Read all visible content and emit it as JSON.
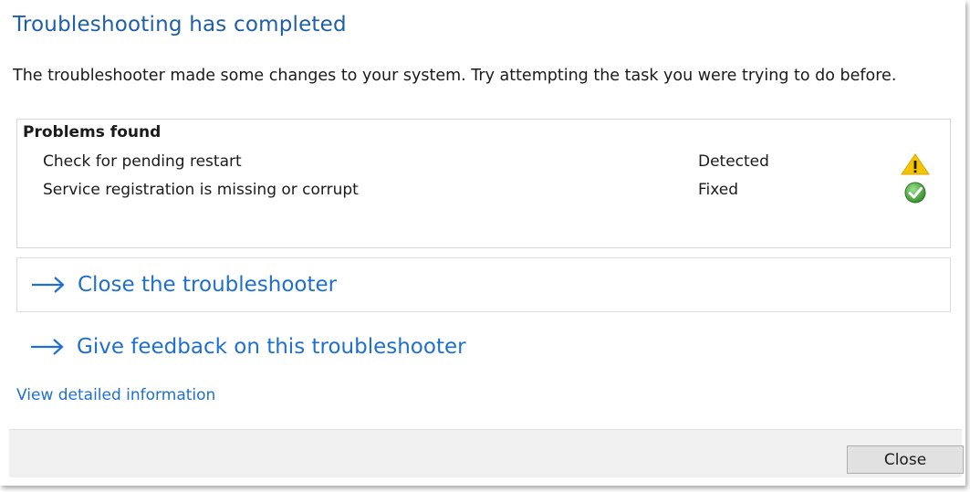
{
  "title": "Troubleshooting has completed",
  "description": "The troubleshooter made some changes to your system. Try attempting the task you were trying to do before.",
  "problems": {
    "header": "Problems found",
    "items": [
      {
        "name": "Check for pending restart",
        "status": "Detected",
        "icon": "warning-icon"
      },
      {
        "name": "Service registration is missing or corrupt",
        "status": "Fixed",
        "icon": "check-icon"
      }
    ]
  },
  "links": {
    "close_troubleshooter": "Close the troubleshooter",
    "give_feedback": "Give feedback on this troubleshooter",
    "view_details": "View detailed information"
  },
  "footer": {
    "close_label": "Close"
  },
  "colors": {
    "title": "#1e5fa6",
    "link": "#1e6fd0",
    "warning": "#f5c400",
    "success": "#3a9a2e"
  }
}
